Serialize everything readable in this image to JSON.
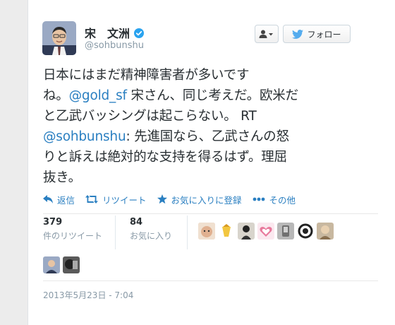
{
  "tweet": {
    "author_name": "宋　文洲",
    "handle": "@sohbunshu",
    "follow_label": "フォロー",
    "text_part1": "日本にはまだ精神障害者が多いです\nね。",
    "mention1": "@gold_sf",
    "text_part2": " 宋さん、同じ考えだ。欧米だ\nと乙武バッシングは起こらない。 RT\n",
    "mention2": "@sohbunshu",
    "text_part3": ": 先進国なら、乙武さんの怒\nりと訴えは絶対的な支持を得るはず。理屈\n抜き。",
    "timestamp": "2013年5月23日 - 7:04"
  },
  "actions": {
    "reply": "返信",
    "retweet": "リツイート",
    "favorite": "お気に入りに登録",
    "more": "その他"
  },
  "stats": {
    "retweets_count": "379",
    "retweets_label": "件のリツイート",
    "favorites_count": "84",
    "favorites_label": "お気に入り"
  },
  "colors": {
    "link": "#2a7fc1",
    "verified": "#2aa3ef",
    "text": "#292f33",
    "muted": "#8899a6"
  }
}
